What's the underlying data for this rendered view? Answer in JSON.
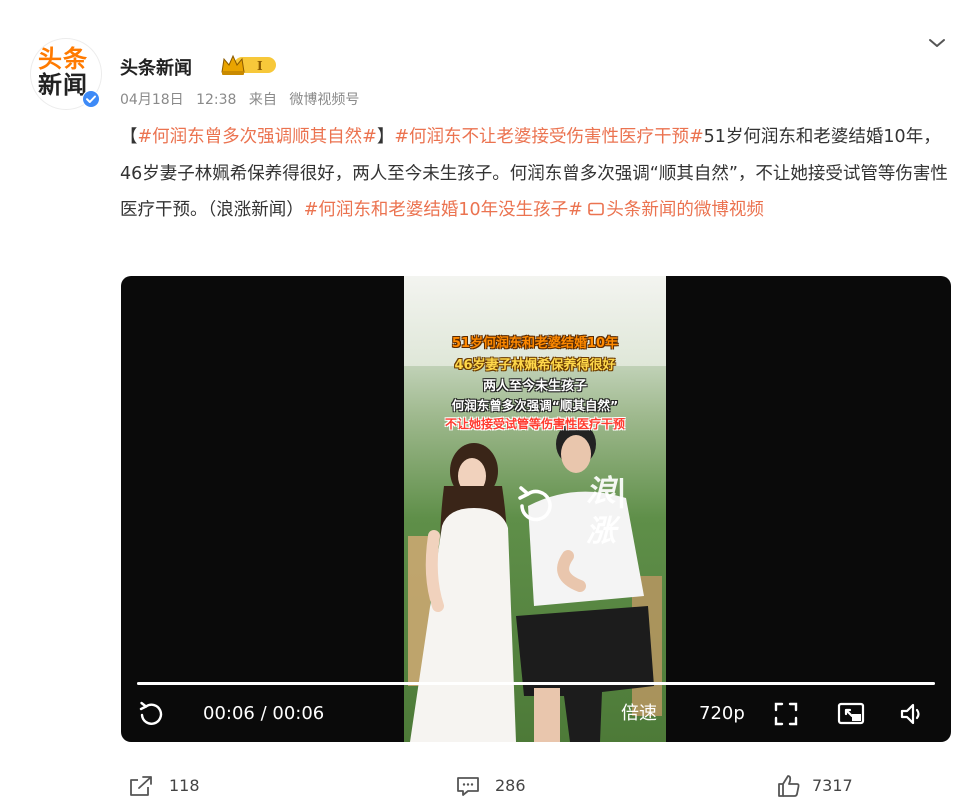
{
  "post": {
    "author": "头条新闻",
    "avatar_logo": {
      "line1": "头条",
      "line2": "新闻"
    },
    "vip_level": "Ⅰ",
    "date": "04月18日",
    "time": "12:38",
    "source_prefix": "来自",
    "source": "微博视频号",
    "text": {
      "bracket_open": "【",
      "tag1": "#何润东曾多次强调顺其自然#",
      "bracket_close": "】",
      "tag2": "#何润东不让老婆接受伤害性医疗干预#",
      "body": "51岁何润东和老婆结婚10年，46岁妻子林姵希保养得很好，两人至今未生孩子。何润东曾多次强调“顺其自然”，不让她接受试管等伤害性医疗干预。（浪涨新闻）",
      "tag3": "#何润东和老婆结婚10年没生孩子#",
      "video_link_icon": "video-link-icon",
      "video_link": "头条新闻的微博视频"
    }
  },
  "video": {
    "captions": [
      "51岁何润东和老婆结婚10年",
      "46岁妻子林姵希保养得很好",
      "两人至今未生孩子",
      "何润东曾多次强调“顺其自然”",
      "不让她接受试管等伤害性医疗干预"
    ],
    "watermark": "浪|涨",
    "progress": 1.0,
    "current_time": "00:06",
    "duration": "00:06",
    "time_separator": " / ",
    "speed_label": "倍速",
    "quality_label": "720p",
    "icons": [
      "replay-icon",
      "fullscreen-icon",
      "pip-icon",
      "volume-icon"
    ]
  },
  "actions": {
    "share_count": "118",
    "comment_count": "286",
    "like_count": "7317"
  },
  "colors": {
    "hashtag": "#eb7350",
    "logo_orange": "#ff7a00",
    "verify_blue": "#3d8af7",
    "vip_gold": "#f5b800"
  }
}
